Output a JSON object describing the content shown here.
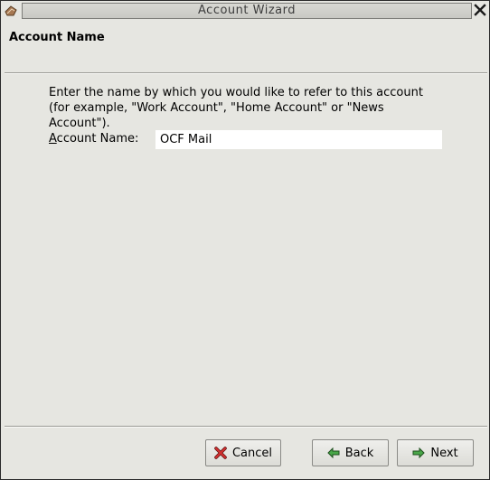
{
  "window": {
    "title": "Account Wizard"
  },
  "page": {
    "heading": "Account Name",
    "description": "Enter the name by which you would like to refer to this account (for example, \"Work Account\", \"Home Account\" or \"News Account\").",
    "field_label_mnemonic": "A",
    "field_label_rest": "ccount Name:",
    "field_value": "OCF Mail"
  },
  "buttons": {
    "cancel": "Cancel",
    "back": "Back",
    "next": "Next"
  },
  "icons": {
    "app": "mail-account-icon",
    "close": "close-icon",
    "cancel": "red-x-icon",
    "back": "green-arrow-left-icon",
    "next": "green-arrow-right-icon"
  },
  "colors": {
    "background": "#e6e6e1",
    "cancel_icon": "#c62828",
    "arrow_icon": "#3a9a3a"
  }
}
